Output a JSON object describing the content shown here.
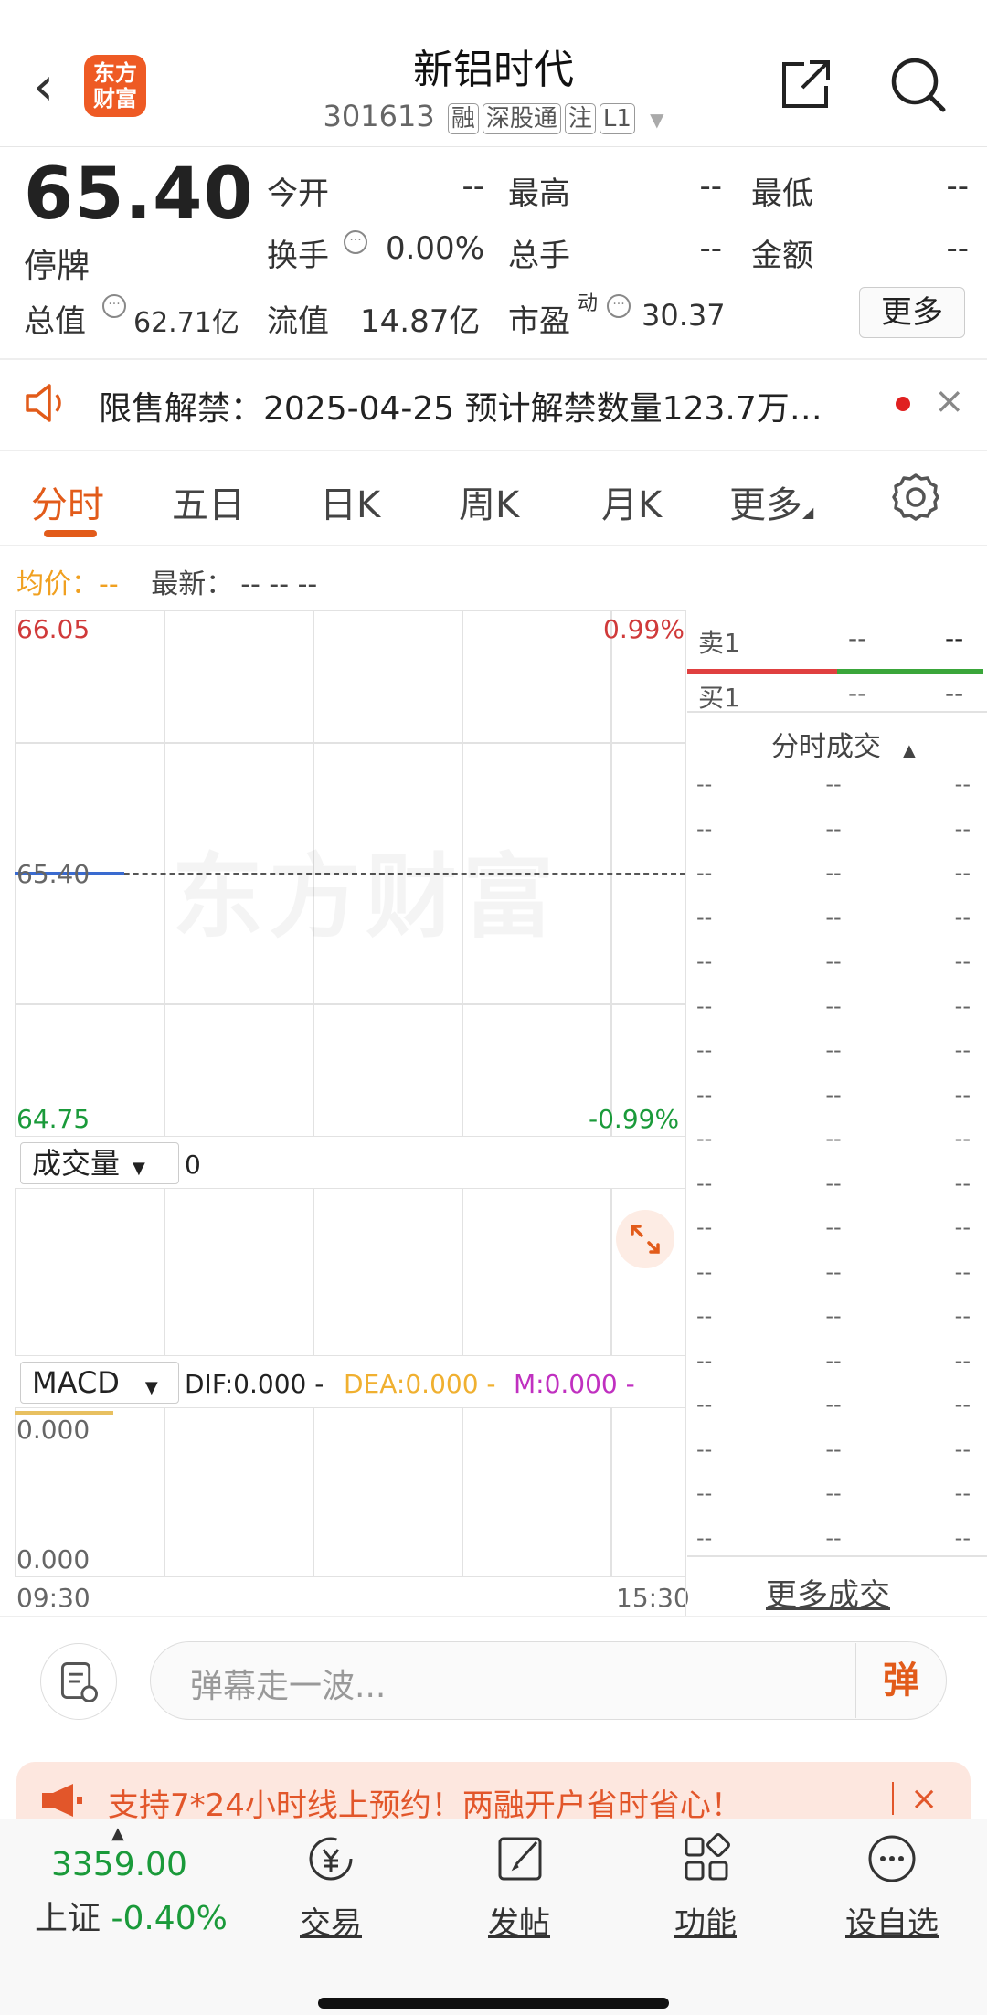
{
  "header": {
    "back_glyph": "‹",
    "logo_text": "东方财富",
    "title": "新铝时代",
    "code": "301613",
    "tags": [
      "融",
      "深股通",
      "注",
      "L1"
    ]
  },
  "quote": {
    "price": "65.40",
    "status": "停牌",
    "fields": [
      {
        "label": "今开",
        "value": "--"
      },
      {
        "label": "最高",
        "value": "--"
      },
      {
        "label": "最低",
        "value": "--"
      },
      {
        "label": "换手",
        "value": "0.00%"
      },
      {
        "label": "总手",
        "value": "--"
      },
      {
        "label": "金额",
        "value": "--"
      },
      {
        "label": "总值",
        "value": "62.71亿"
      },
      {
        "label": "流值",
        "value": "14.87亿"
      },
      {
        "label": "市盈",
        "sup": "动",
        "value": "30.37"
      }
    ],
    "more_label": "更多"
  },
  "notice": {
    "text": "限售解禁：2025-04-25 预计解禁数量123.7万…",
    "close": "×"
  },
  "tabs": [
    "分时",
    "五日",
    "日K",
    "周K",
    "月K",
    "更多"
  ],
  "avg": {
    "label": "均价：",
    "value": "--",
    "latest_label": "最新：",
    "latest_values": "--  --  --"
  },
  "chart": {
    "top_left": "66.05",
    "top_right": "0.99%",
    "mid_left": "65.40",
    "bottom_left": "64.75",
    "bottom_right": "-0.99%",
    "volume_select": "成交量",
    "volume_value": "0",
    "macd_select": "MACD",
    "dif": "DIF:0.000 -",
    "dea": "DEA:0.000 -",
    "m": "M:0.000 -",
    "macd_top": "0.000",
    "macd_bottom": "0.000",
    "time_start": "09:30",
    "time_end": "15:30",
    "watermark": "东方财富",
    "colors": {
      "up": "#d03a3a",
      "down": "#1a9a3a",
      "dea": "#f0b030",
      "m": "#c030c0"
    }
  },
  "orderbook": {
    "sell1": {
      "label": "卖1",
      "price": "--",
      "vol": "--"
    },
    "buy1": {
      "label": "买1",
      "price": "--",
      "vol": "--"
    },
    "trades_title": "分时成交",
    "trade_rows": 18,
    "trade_cell": "--",
    "more_trades": "更多成交"
  },
  "comment": {
    "placeholder": "弹幕走一波...",
    "danmu": "弹"
  },
  "promo": {
    "text": "支持7*24小时线上预约！两融开户省时省心！",
    "close": "×"
  },
  "tabbar": {
    "index_value": "3359.00",
    "index_name": "上证",
    "index_change": "-0.40%",
    "items": [
      "交易",
      "发帖",
      "功能",
      "设自选"
    ]
  }
}
